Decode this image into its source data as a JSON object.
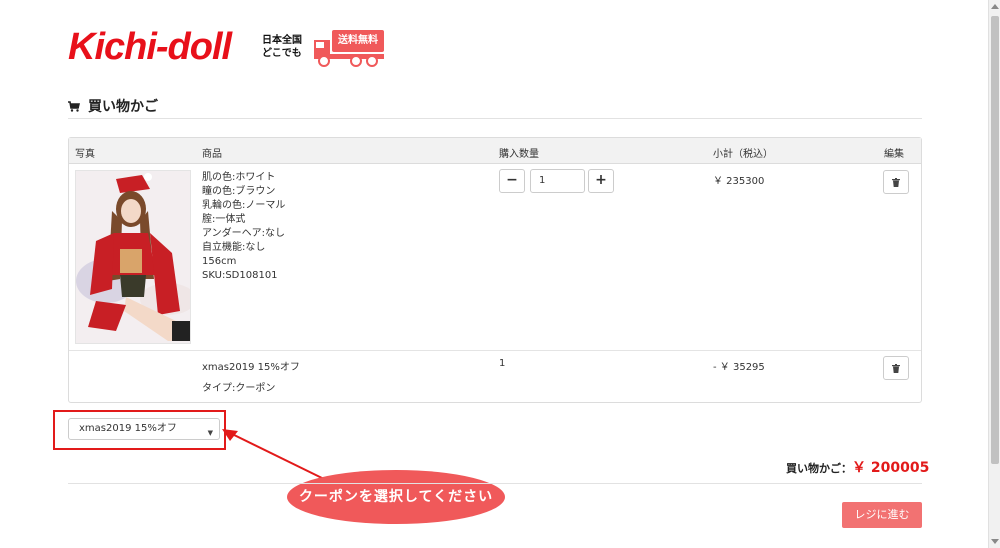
{
  "brand": {
    "logo_text": "Kichi-doll",
    "shipping_line1": "日本全国",
    "shipping_line2": "どこでも",
    "shipping_badge": "送料無料",
    "accent_color": "#e8101a"
  },
  "cart": {
    "title": "買い物かご",
    "title_icon": "cart-icon",
    "columns": {
      "photo": "写真",
      "product": "商品",
      "quantity": "購入数量",
      "subtotal": "小計（税込）",
      "edit": "編集"
    },
    "items": [
      {
        "attributes": [
          "肌の色:ホワイト",
          "瞳の色:ブラウン",
          "乳輪の色:ノーマル",
          "腟:一体式",
          "アンダーヘア:なし",
          "自立機能:なし",
          "156cm",
          "SKU:SD108101"
        ],
        "quantity": "1",
        "subtotal": "￥ 235300",
        "minus_label": "−",
        "plus_label": "+"
      }
    ],
    "coupon": {
      "name": "xmas2019 15%オフ",
      "type": "タイプ:クーポン",
      "quantity": "1",
      "subtotal": "- ￥ 35295"
    },
    "coupon_select_value": "xmas2019 15%オフ",
    "total_label": "買い物かご：",
    "total_value": "￥ 200005",
    "checkout_label": "レジに進む"
  },
  "annotation": {
    "bubble_text": "クーポンを選択してください",
    "highlight_color": "#e21a1a"
  }
}
